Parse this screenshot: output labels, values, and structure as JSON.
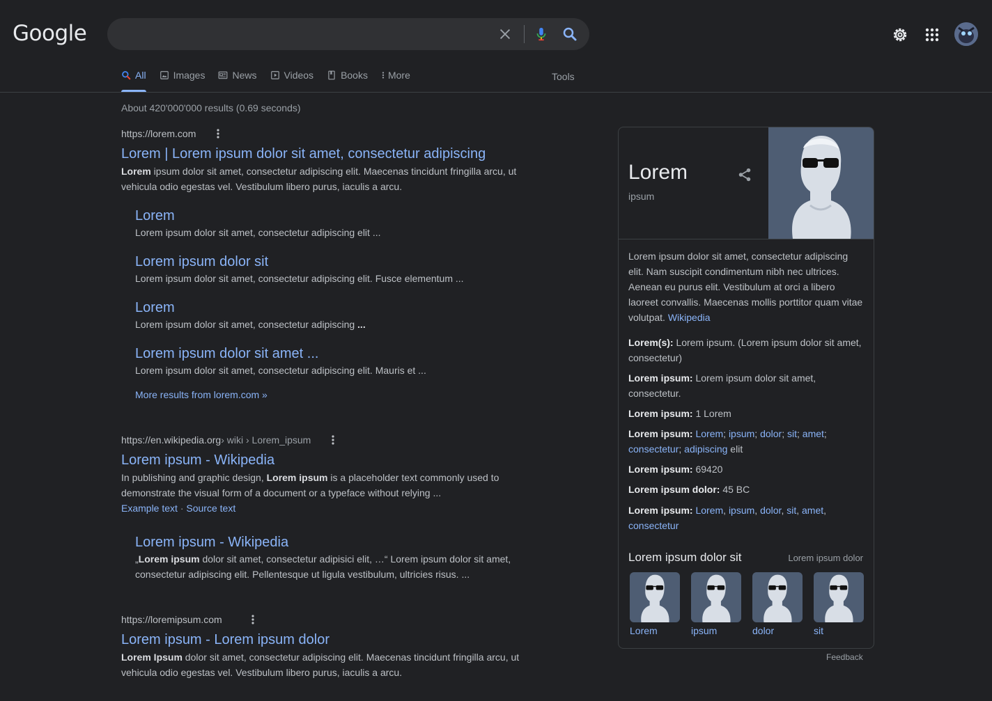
{
  "header": {
    "logo": "Google",
    "search": {
      "value": "",
      "placeholder": ""
    }
  },
  "tabs": [
    {
      "label": "All",
      "icon": "search-icon",
      "active": true
    },
    {
      "label": "Images",
      "icon": "image-icon"
    },
    {
      "label": "News",
      "icon": "news-icon"
    },
    {
      "label": "Videos",
      "icon": "play-icon"
    },
    {
      "label": "Books",
      "icon": "book-icon"
    },
    {
      "label": "More",
      "icon": "more-vert-icon"
    }
  ],
  "tools_label": "Tools",
  "result_stats": "About 420'000'000 results (0.69 seconds)",
  "results": [
    {
      "url": "https://lorem.com",
      "title": "Lorem | Lorem ipsum dolor sit amet, consectetur adipiscing",
      "snippet_bold": "Lorem",
      "snippet": " ipsum dolor sit amet, consectetur adipiscing elit. Maecenas tincidunt fringilla arcu, ut vehicula odio egestas vel. Vestibulum libero purus, iaculis a arcu.",
      "sitelinks": [
        {
          "title": "Lorem",
          "snippet": "Lorem ipsum dolor sit amet, consectetur adipiscing elit ..."
        },
        {
          "title": "Lorem ipsum dolor sit",
          "snippet": "Lorem ipsum dolor sit amet, consectetur adipiscing elit. Fusce elementum ..."
        },
        {
          "title": "Lorem",
          "snippet": "Lorem ipsum dolor sit amet, consectetur adipiscing ",
          "snippet_bold_tail": "..."
        },
        {
          "title": "Lorem ipsum dolor sit amet ...",
          "snippet": "Lorem ipsum dolor sit amet, consectetur adipiscing elit. Mauris et ..."
        }
      ],
      "more_results": "More results from lorem.com »"
    },
    {
      "url": "https://en.wikipedia.org",
      "breadcrumb": " › wiki › Lorem_ipsum",
      "title": "Lorem ipsum - Wikipedia",
      "snippet_pre": "In publishing and graphic design, ",
      "snippet_bold": "Lorem ipsum",
      "snippet": " is a placeholder text commonly used to demonstrate the visual form of a document or a typeface without relying ...",
      "links": [
        "Example text",
        "Source text"
      ],
      "link_sep": " · ",
      "sub": {
        "title": "Lorem ipsum - Wikipedia",
        "snippet_pre": "„",
        "snippet_bold": "Lorem ipsum",
        "snippet": " dolor sit amet, consectetur adipisici elit, …“ Lorem ipsum dolor sit amet, consectetur adipiscing elit. Pellentesque ut ligula vestibulum, ultricies risus. ..."
      }
    },
    {
      "url": "https://loremipsum.com",
      "title": "Lorem ipsum - Lorem ipsum dolor",
      "snippet_bold": "Lorem Ipsum",
      "snippet": " dolor sit amet, consectetur adipiscing elit. Maecenas tincidunt fringilla arcu, ut vehicula odio egestas vel. Vestibulum libero purus, iaculis a arcu."
    }
  ],
  "kp": {
    "title": "Lorem",
    "subtitle": "ipsum",
    "description": "Lorem ipsum dolor sit amet, consectetur adipiscing elit. Nam suscipit condimentum nibh nec ultrices. Aenean eu purus elit. Vestibulum at orci a libero laoreet convallis. Maecenas mollis porttitor quam vitae volutpat. ",
    "wiki_link": "Wikipedia",
    "facts": [
      {
        "label": "Lorem(s):",
        "text": " Lorem ipsum. (Lorem ipsum dolor sit amet, consectetur)"
      },
      {
        "label": "Lorem ipsum:",
        "text": " Lorem ipsum dolor sit amet, consectetur."
      },
      {
        "label": "Lorem ipsum:",
        "text": " 1 Lorem"
      },
      {
        "label": "Lorem ipsum:",
        "links": [
          "Lorem",
          "ipsum",
          "dolor",
          "sit",
          "amet",
          "consectetur",
          "adipiscing"
        ],
        "sep": "; ",
        "tail": " elit"
      },
      {
        "label": "Lorem ipsum:",
        "text": " 69420"
      },
      {
        "label": "Lorem ipsum dolor:",
        "text": " 45 BC"
      },
      {
        "label": "Lorem ipsum:",
        "links": [
          "Lorem",
          "ipsum",
          "dolor",
          "sit",
          "amet",
          "consectetur"
        ],
        "sep": ", "
      }
    ],
    "related_title": "Lorem ipsum dolor sit",
    "related_more": "Lorem ipsum dolor",
    "related": [
      "Lorem",
      "ipsum",
      "dolor",
      "sit"
    ]
  },
  "feedback": "Feedback",
  "colors": {
    "background": "#202124",
    "link": "#8ab4f8",
    "text": "#bdc1c6",
    "search_box": "#303134"
  }
}
